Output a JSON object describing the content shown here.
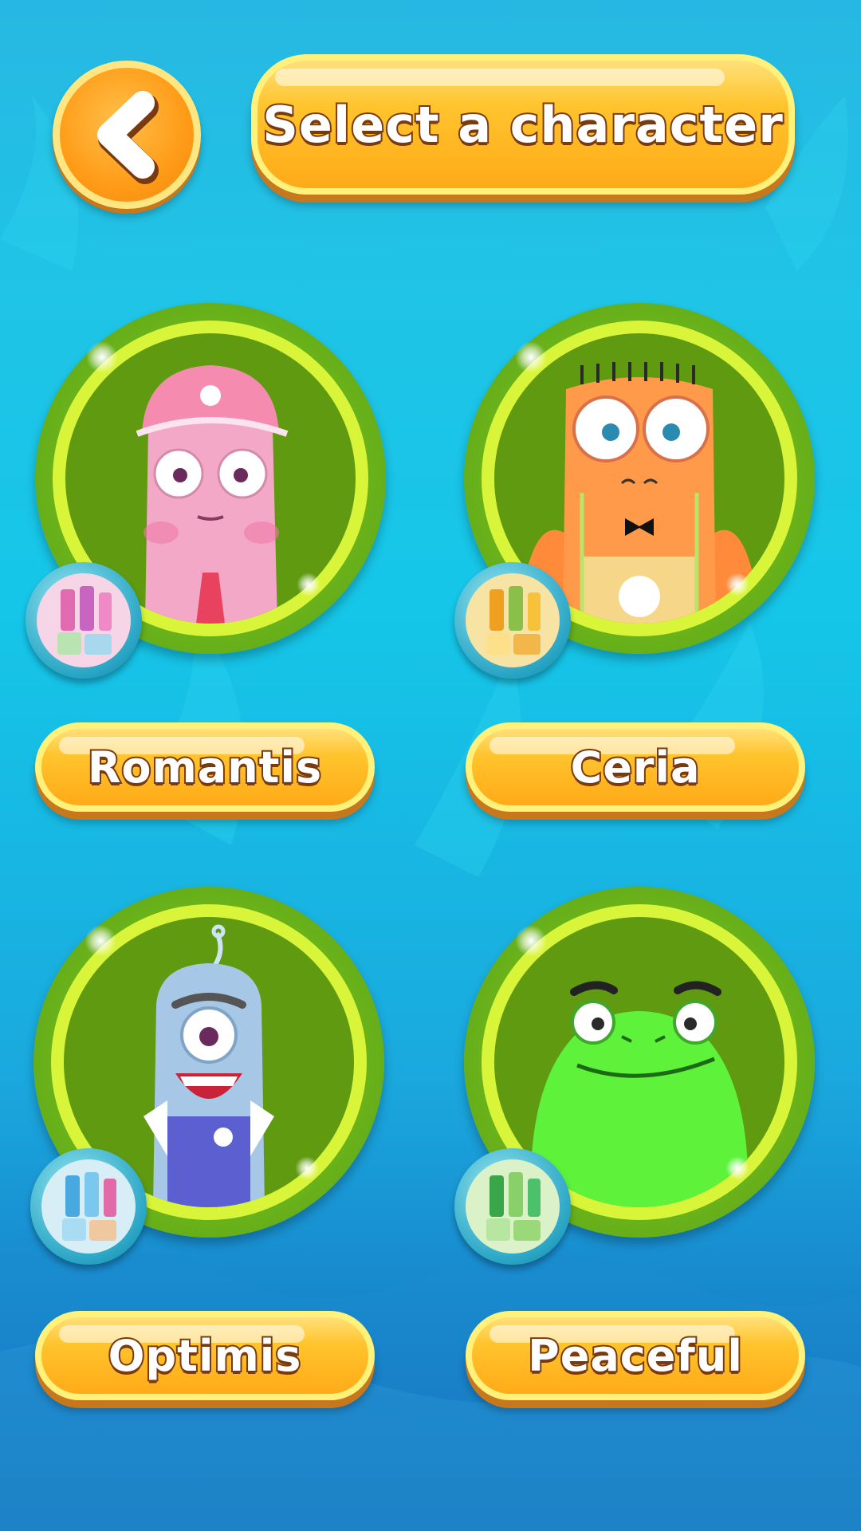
{
  "header": {
    "title": "Select a character",
    "back_icon": "chevron-left-icon"
  },
  "characters": [
    {
      "id": "romantis",
      "label": "Romantis",
      "color": "#f3a8c8",
      "badge_color": "#f6d5e6"
    },
    {
      "id": "ceria",
      "label": "Ceria",
      "color": "#ff9a4a",
      "badge_color": "#f7e3a4"
    },
    {
      "id": "optimis",
      "label": "Optimis",
      "color": "#a7c7e6",
      "badge_color": "#d7eef6"
    },
    {
      "id": "peaceful",
      "label": "Peaceful",
      "color": "#5ef23b",
      "badge_color": "#dbf2c8"
    }
  ],
  "colors": {
    "accent": "#ffb21e",
    "ring_green": "#6bb41a",
    "text_outline": "#7a3a10"
  }
}
